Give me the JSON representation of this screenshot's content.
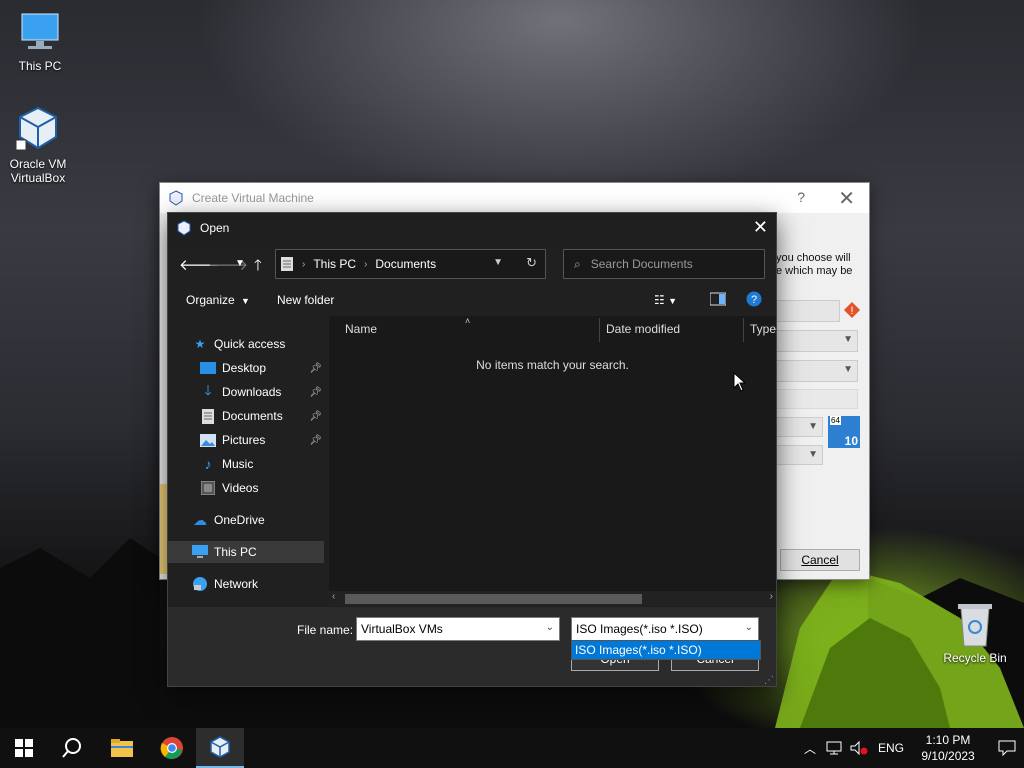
{
  "desktop": {
    "icons": [
      {
        "label": "This PC"
      },
      {
        "label": "Oracle VM VirtualBox"
      },
      {
        "label": "Recycle Bin"
      }
    ]
  },
  "background_window": {
    "title": "Create Virtual Machine",
    "help_glyph": "?",
    "close_glyph": "✕",
    "partial_text_line1": "you choose will",
    "partial_text_line2": "e which may be",
    "cancel_label": "Cancel",
    "os_badge": {
      "top": "64",
      "number": "10"
    }
  },
  "open_dialog": {
    "title": "Open",
    "close_glyph": "✕",
    "breadcrumb": [
      "This PC",
      "Documents"
    ],
    "search_placeholder": "Search Documents",
    "toolbar": {
      "organize": "Organize",
      "new_folder": "New folder"
    },
    "nav": [
      {
        "label": "Quick access",
        "icon": "star-icon"
      },
      {
        "label": "Desktop",
        "icon": "desktop-icon",
        "pinned": true
      },
      {
        "label": "Downloads",
        "icon": "download-icon",
        "pinned": true
      },
      {
        "label": "Documents",
        "icon": "document-icon",
        "pinned": true
      },
      {
        "label": "Pictures",
        "icon": "pictures-icon",
        "pinned": true
      },
      {
        "label": "Music",
        "icon": "music-icon"
      },
      {
        "label": "Videos",
        "icon": "videos-icon"
      },
      {
        "label": "OneDrive",
        "icon": "cloud-icon"
      },
      {
        "label": "This PC",
        "icon": "pc-icon",
        "selected": true
      },
      {
        "label": "Network",
        "icon": "network-icon"
      }
    ],
    "columns": [
      "Name",
      "Date modified",
      "Type"
    ],
    "empty_message": "No items match your search.",
    "file_name_label": "File name:",
    "file_name_value": "VirtualBox VMs",
    "file_type_value": "ISO Images(*.iso *.ISO)",
    "file_type_options": [
      "ISO Images(*.iso *.ISO)"
    ],
    "open_label": "Open",
    "cancel_label": "Cancel"
  },
  "taskbar": {
    "language": "ENG",
    "time": "1:10 PM",
    "date": "9/10/2023"
  },
  "colors": {
    "accent": "#0078d7",
    "dialog_bg": "#202020",
    "taskbar_bg": "#101010"
  }
}
